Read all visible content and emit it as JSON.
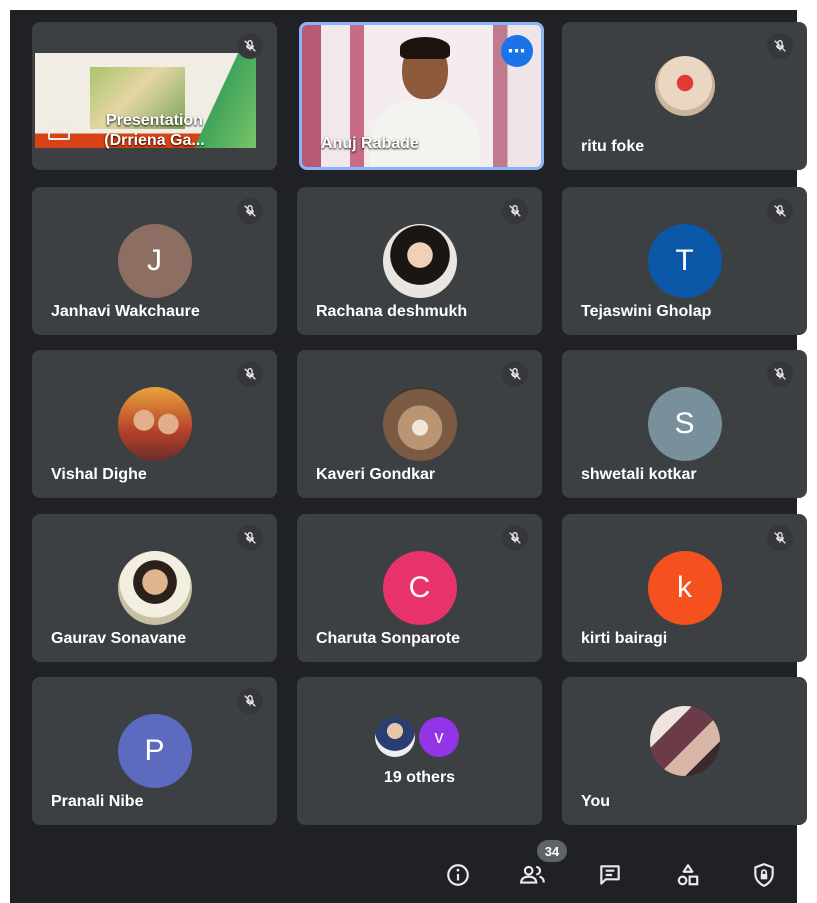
{
  "tiles": {
    "presentation": {
      "title": "Presentation",
      "subtitle": "(Drriena Ga..."
    },
    "anuj": {
      "name": "Anuj Rabade",
      "more": "⋯"
    },
    "ritu": {
      "name": "ritu foke"
    },
    "janhavi": {
      "name": "Janhavi Wakchaure",
      "initial": "J"
    },
    "rachana": {
      "name": "Rachana deshmukh"
    },
    "tejaswini": {
      "name": "Tejaswini Gholap",
      "initial": "T"
    },
    "vishal": {
      "name": "Vishal Dighe"
    },
    "kaveri": {
      "name": "Kaveri Gondkar"
    },
    "shwetali": {
      "name": "shwetali kotkar",
      "initial": "S"
    },
    "gaurav": {
      "name": "Gaurav Sonavane"
    },
    "charuta": {
      "name": "Charuta Sonparote",
      "initial": "C"
    },
    "kirti": {
      "name": "kirti bairagi",
      "initial": "k"
    },
    "pranali": {
      "name": "Pranali Nibe",
      "initial": "P"
    },
    "others": {
      "label": "19 others",
      "initial": "v"
    },
    "you": {
      "name": "You"
    }
  },
  "colors": {
    "janhavi": "#8d6e63",
    "tejaswini": "#0b57a8",
    "shwetali": "#78909c",
    "charuta": "#e8336d",
    "kirti": "#f4511e",
    "pranali": "#5c6bc0",
    "others_v": "#9334e6",
    "active_speaker_border": "#8ab4f8"
  },
  "toolbar": {
    "people_count": "34",
    "icons": [
      "info-icon",
      "people-icon",
      "chat-icon",
      "activities-icon",
      "host-controls-icon"
    ]
  }
}
